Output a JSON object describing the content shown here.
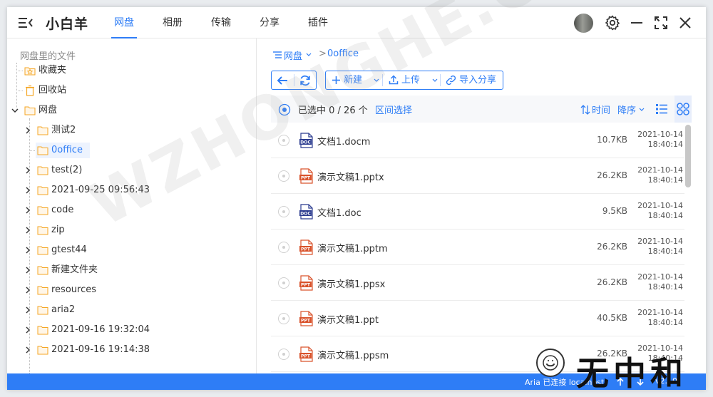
{
  "app": {
    "brand": "小白羊",
    "tabs": [
      {
        "label": "网盘",
        "active": true
      },
      {
        "label": "相册",
        "active": false
      },
      {
        "label": "传输",
        "active": false
      },
      {
        "label": "分享",
        "active": false
      },
      {
        "label": "插件",
        "active": false
      }
    ],
    "accent_color": "#2e7df6"
  },
  "tree": {
    "root_label": "网盘里的文件",
    "fixed": [
      {
        "label": "收藏夹",
        "icon": "star-folder-icon"
      },
      {
        "label": "回收站",
        "icon": "trash-icon"
      }
    ],
    "disk_label": "网盘",
    "children": [
      {
        "label": "测试2",
        "expandable": true,
        "selected": false
      },
      {
        "label": "0office",
        "expandable": false,
        "selected": true
      },
      {
        "label": "test(2)",
        "expandable": true,
        "selected": false
      },
      {
        "label": "2021-09-25 09:56:43",
        "expandable": true,
        "selected": false
      },
      {
        "label": "code",
        "expandable": true,
        "selected": false
      },
      {
        "label": "zip",
        "expandable": true,
        "selected": false
      },
      {
        "label": "gtest44",
        "expandable": true,
        "selected": false
      },
      {
        "label": "新建文件夹",
        "expandable": true,
        "selected": false
      },
      {
        "label": "resources",
        "expandable": true,
        "selected": false
      },
      {
        "label": "aria2",
        "expandable": true,
        "selected": false
      },
      {
        "label": "2021-09-16 19:32:04",
        "expandable": true,
        "selected": false
      },
      {
        "label": "2021-09-16 19:14:38",
        "expandable": true,
        "selected": false
      }
    ]
  },
  "breadcrumb": {
    "root": "网盘",
    "separator": ">",
    "current": "0office"
  },
  "toolbar": {
    "new_label": "新建",
    "upload_label": "上传",
    "import_share_label": "导入分享"
  },
  "selection": {
    "selected_text": "已选中 0 / 26 个",
    "range_select": "区间选择",
    "sort_field": "时间",
    "sort_order": "降序"
  },
  "files": [
    {
      "name": "文档1.docm",
      "type": "doc",
      "size": "10.7KB",
      "date": "2021-10-14",
      "time": "18:40:14"
    },
    {
      "name": "演示文稿1.pptx",
      "type": "ppt",
      "size": "26.2KB",
      "date": "2021-10-14",
      "time": "18:40:14"
    },
    {
      "name": "文档1.doc",
      "type": "doc",
      "size": "9.5KB",
      "date": "2021-10-14",
      "time": "18:40:14"
    },
    {
      "name": "演示文稿1.pptm",
      "type": "ppt",
      "size": "26.2KB",
      "date": "2021-10-14",
      "time": "18:40:14"
    },
    {
      "name": "演示文稿1.ppsx",
      "type": "ppt",
      "size": "26.2KB",
      "date": "2021-10-14",
      "time": "18:40:14"
    },
    {
      "name": "演示文稿1.ppt",
      "type": "ppt",
      "size": "40.5KB",
      "date": "2021-10-14",
      "time": "18:40:14"
    },
    {
      "name": "演示文稿1.ppsm",
      "type": "ppt",
      "size": "26.2KB",
      "date": "2021-10-14",
      "time": "18:40:14"
    }
  ],
  "statusbar": {
    "aria_text": "Aria 已连接 localhost",
    "version": "v2.10"
  },
  "watermark": {
    "text": "WZHONGHE.COM",
    "logo": "无中和"
  }
}
